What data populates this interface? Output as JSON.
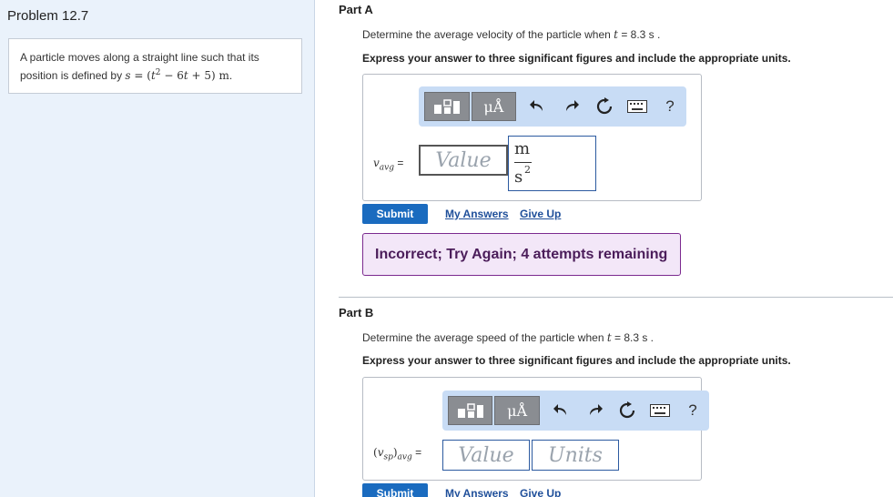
{
  "problem": {
    "title": "Problem 12.7",
    "text_prefix": "A particle moves along a straight line such that its position is defined by ",
    "equation": {
      "var": "s",
      "eq": " = (",
      "t": "t",
      "exp": "2",
      "rest": " − 6",
      "t2": "t",
      "tail": " + 5) ",
      "unit": "m",
      "dot": "."
    }
  },
  "part_a": {
    "title": "Part A",
    "question_prefix": "Determine the average velocity of the particle when ",
    "var": "t",
    "question_suffix": " = 8.3  s .",
    "instruction": "Express your answer to three significant figures and include the appropriate units.",
    "toolbar": {
      "templates_label": "▗▖▘",
      "mu_label": "μÅ",
      "help_label": "?"
    },
    "label_var": "v",
    "label_sub": "avg",
    "label_eq": " =",
    "value_placeholder": "Value",
    "unit_numerator": "m",
    "unit_denominator": "s",
    "unit_exponent": "2",
    "submit": "Submit",
    "my_answers": "My Answers",
    "give_up": "Give Up",
    "feedback": "Incorrect; Try Again; 4 attempts remaining"
  },
  "part_b": {
    "title": "Part B",
    "question_prefix": "Determine the average speed of the particle when ",
    "var": "t",
    "question_suffix": " = 8.3  s .",
    "instruction": "Express your answer to three significant figures and include the appropriate units.",
    "toolbar": {
      "mu_label": "μÅ",
      "help_label": "?"
    },
    "label_open": "(",
    "label_var": "v",
    "label_sub": "sp",
    "label_close": ")",
    "label_sub2": "avg",
    "label_eq": " =",
    "value_placeholder": "Value",
    "units_placeholder": "Units",
    "submit": "Submit",
    "my_answers": "My Answers",
    "give_up": "Give Up"
  },
  "colors": {
    "panel_bg": "#eaf2fb",
    "toolbar_bg": "#c8dcf5",
    "submit_bg": "#1a6bbf",
    "link": "#1f4f9a",
    "feedback_bg": "#f3e7f8",
    "feedback_border": "#7b2a8f"
  }
}
